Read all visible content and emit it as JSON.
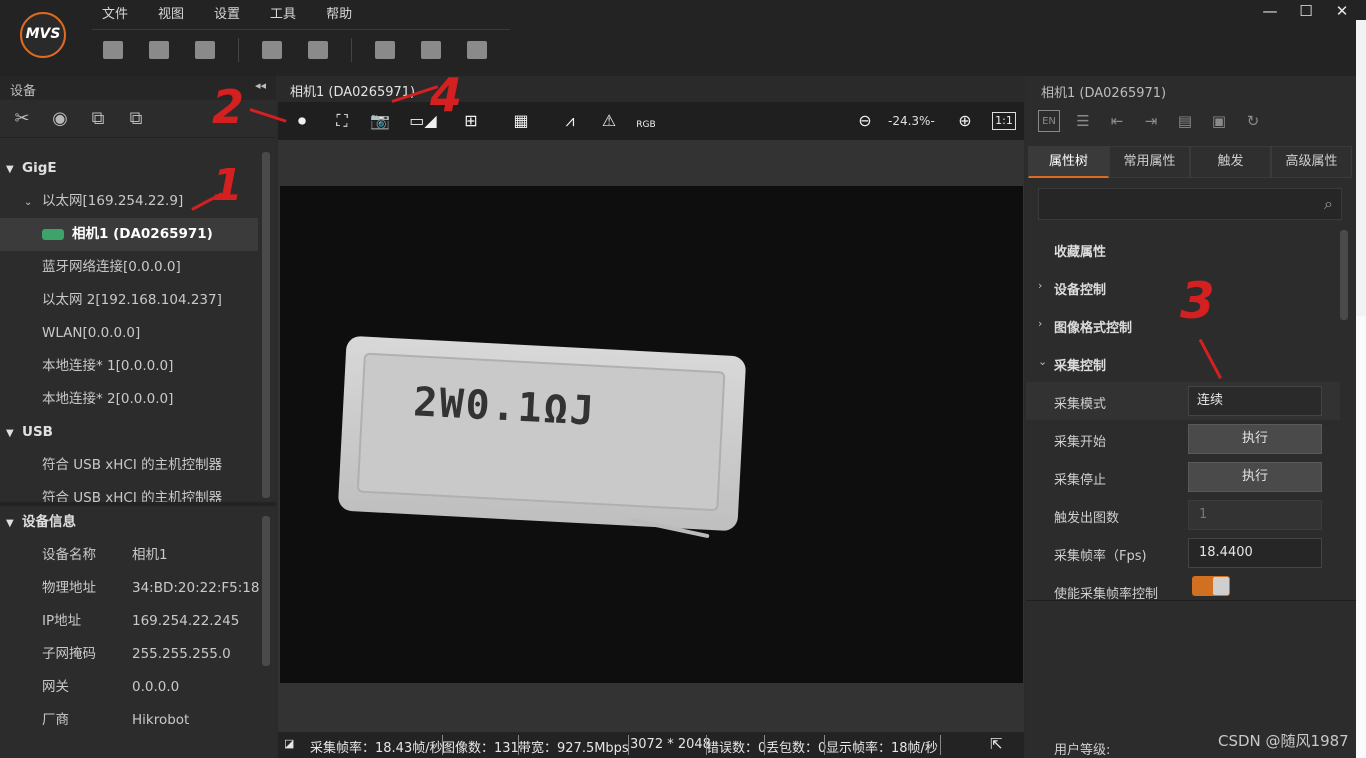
{
  "app": {
    "logo_text": "MVS"
  },
  "menu": [
    "文件",
    "视图",
    "设置",
    "工具",
    "帮助"
  ],
  "window_controls": [
    "—",
    "☐",
    "✕"
  ],
  "left_panel": {
    "title": "设备",
    "collapse": "◂◂",
    "tree": {
      "gige": "GigE",
      "ethernet": "以太网[169.254.22.9]",
      "camera": "相机1 (DA0265971)",
      "bluetooth": "蓝牙网络连接[0.0.0.0]",
      "ethernet2": "以太网 2[192.168.104.237]",
      "wlan": "WLAN[0.0.0.0]",
      "local1": "本地连接* 1[0.0.0.0]",
      "local2": "本地连接* 2[0.0.0.0]",
      "usb": "USB",
      "usb1": "符合 USB xHCI 的主机控制器",
      "usb2": "符合 USB xHCI 的主机控制器"
    },
    "device_info": {
      "title": "设备信息",
      "rows": [
        {
          "k": "设备名称",
          "v": "相机1"
        },
        {
          "k": "物理地址",
          "v": "34:BD:20:22:F5:18"
        },
        {
          "k": "IP地址",
          "v": "169.254.22.245"
        },
        {
          "k": "子网掩码",
          "v": "255.255.255.0"
        },
        {
          "k": "网关",
          "v": "0.0.0.0"
        },
        {
          "k": "厂商",
          "v": "Hikrobot"
        }
      ]
    }
  },
  "center": {
    "tab_title": "相机1 (DA0265971)",
    "zoom": "-24.3%-",
    "one_to_one": "1:1",
    "rgb_label": "RGB",
    "image_text": "2W0.1ΩJ",
    "status": {
      "fps": "采集帧率：18.43帧/秒",
      "images": "图像数：131",
      "bandwidth": "带宽：927.5Mbps",
      "resolution": "3072 * 2048",
      "errors": "错误数：0",
      "lost": "丢包数：0",
      "display_fps": "显示帧率：18帧/秒"
    }
  },
  "right_panel": {
    "title": "相机1 (DA0265971)",
    "en": "EN",
    "tabs": [
      "属性树",
      "常用属性",
      "触发",
      "高级属性"
    ],
    "search_placeholder": "",
    "favorites": "收藏属性",
    "categories": {
      "device_control": "设备控制",
      "image_format": "图像格式控制",
      "acquisition": "采集控制"
    },
    "props": {
      "acq_mode": {
        "name": "采集模式",
        "value": "连续"
      },
      "acq_start": {
        "name": "采集开始",
        "value": "执行"
      },
      "acq_stop": {
        "name": "采集停止",
        "value": "执行"
      },
      "trigger_count": {
        "name": "触发出图数",
        "value": "1"
      },
      "frame_rate": {
        "name": "采集帧率（Fps)",
        "value": "18.4400"
      },
      "frame_rate_enable": {
        "name": "使能采集帧率控制"
      }
    },
    "user_level": "用户等级:"
  },
  "watermark": "CSDN @随风1987",
  "annotations": [
    "1",
    "2",
    "3",
    "4"
  ],
  "colors": {
    "accent": "#e06a1f",
    "annotation": "#d42020",
    "camera_icon": "#3ea36a"
  }
}
